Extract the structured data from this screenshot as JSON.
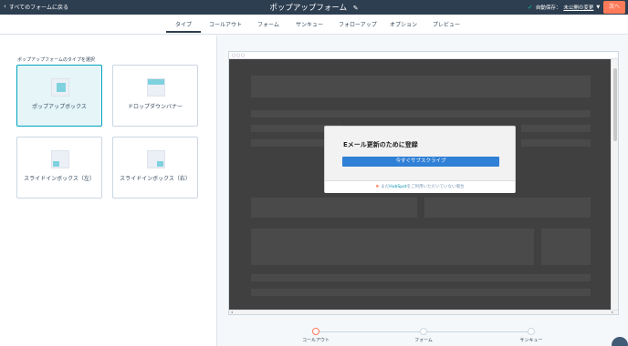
{
  "header": {
    "back_label": "すべてのフォームに戻る",
    "title": "ポップアップフォーム",
    "autosave_label": "自動保存：",
    "autosave_link": "未公開の変更",
    "next_label": "次へ"
  },
  "tabs": [
    {
      "label": "タイプ"
    },
    {
      "label": "コールアウト"
    },
    {
      "label": "フォーム"
    },
    {
      "label": "サンキュー"
    },
    {
      "label": "フォローアップ"
    },
    {
      "label": "オプション"
    },
    {
      "label": "プレビュー"
    }
  ],
  "left": {
    "label": "ポップアップフォームのタイプを選択",
    "cards": [
      {
        "label": "ポップアップボックス",
        "selected": true
      },
      {
        "label": "ドロップダウンバナー",
        "selected": false
      },
      {
        "label": "スライドインボックス（左）",
        "selected": false
      },
      {
        "label": "スライドインボックス（右）",
        "selected": false
      }
    ]
  },
  "preview": {
    "modal_title": "Eメール更新のために登録",
    "modal_button": "今すぐサブスクライブ",
    "footer_prefix": "まだ",
    "footer_brand": "HubSpot",
    "footer_suffix": "をご利用いただいていない場合"
  },
  "stepper": [
    {
      "label": "コールアウト",
      "active": true
    },
    {
      "label": "フォーム",
      "active": false
    },
    {
      "label": "サンキュー",
      "active": false
    }
  ],
  "colors": {
    "topbar": "#2d3e50",
    "accent": "#ff7a59",
    "selected": "#00a4bd",
    "modal_button": "#2f80d6"
  }
}
